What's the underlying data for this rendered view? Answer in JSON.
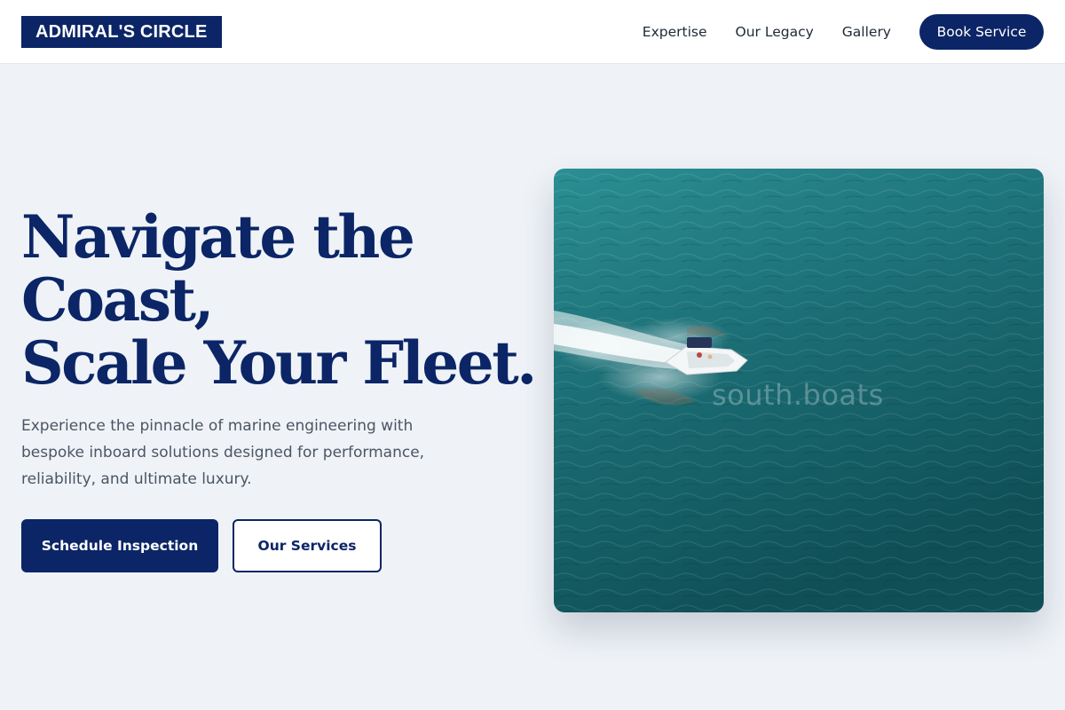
{
  "brand": {
    "logo_text": "ADMIRAL'S CIRCLE"
  },
  "nav": {
    "links": [
      {
        "label": "Expertise"
      },
      {
        "label": "Our Legacy"
      },
      {
        "label": "Gallery"
      }
    ],
    "cta_label": "Book Service"
  },
  "hero": {
    "headline_lines": [
      "Navigate the",
      "Coast,",
      "Scale Your Fleet."
    ],
    "subtitle": "Experience the pinnacle of marine engineering with bespoke inboard solutions designed for performance, reliability, and ultimate luxury.",
    "primary_cta": "Schedule Inspection",
    "secondary_cta": "Our Services",
    "image_watermark": "south.boats"
  },
  "colors": {
    "brand_navy": "#0b2566",
    "page_background": "#eff3f7",
    "sea_teal": "#1c6f76"
  }
}
